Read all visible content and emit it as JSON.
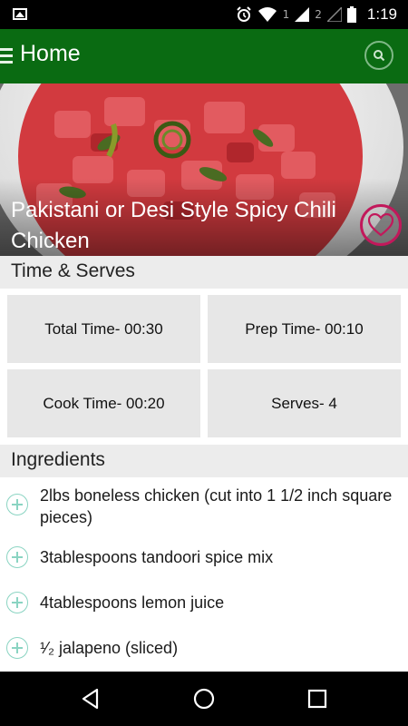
{
  "status_bar": {
    "sim1": "1",
    "sim2": "2",
    "time": "1:19"
  },
  "app_bar": {
    "title": "Home"
  },
  "recipe": {
    "title": "Pakistani or Desi Style Spicy Chili Chicken"
  },
  "time_serves": {
    "header": "Time & Serves",
    "total_time": "Total Time- 00:30",
    "prep_time": "Prep Time- 00:10",
    "cook_time": "Cook Time- 00:20",
    "serves": "Serves- 4"
  },
  "ingredients": {
    "header": "Ingredients",
    "items": [
      "2lbs boneless chicken (cut into 1 1/2 inch square pieces)",
      "3tablespoons tandoori spice mix",
      "4tablespoons lemon juice",
      "¹⁄₂ jalapeno (sliced)"
    ]
  },
  "colors": {
    "app_bar": "#0a6b12",
    "favorite": "#c2185b",
    "add_icon": "#8ad4c2"
  }
}
